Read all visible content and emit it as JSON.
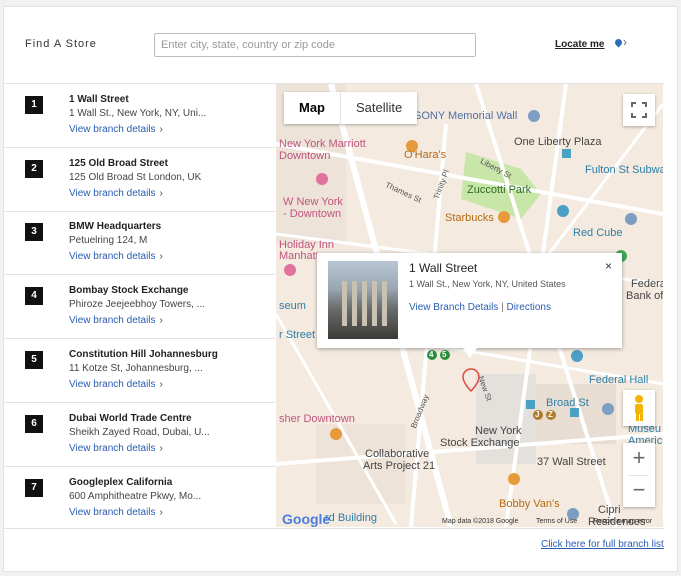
{
  "header": {
    "title": "Find A Store",
    "search_placeholder": "Enter city, state, country or zip code",
    "locate_label": "Locate me"
  },
  "stores": [
    {
      "num": "1",
      "name": "1 Wall Street",
      "address": "1 Wall St., New York, NY, Uni...",
      "link": "View branch details"
    },
    {
      "num": "2",
      "name": "125 Old Broad Street",
      "address": "125 Old Broad St London, UK",
      "link": "View branch details"
    },
    {
      "num": "3",
      "name": "BMW Headquarters",
      "address": "Petuelring 124, M",
      "link": "View branch details"
    },
    {
      "num": "4",
      "name": "Bombay Stock Exchange",
      "address": "Phiroze Jeejeebhoy Towers, ...",
      "link": "View branch details"
    },
    {
      "num": "5",
      "name": "Constitution Hill Johannesburg",
      "address": "11 Kotze St, Johannesburg, ...",
      "link": "View branch details"
    },
    {
      "num": "6",
      "name": "Dubai World Trade Centre",
      "address": "Sheikh Zayed Road, Dubai, U...",
      "link": "View branch details"
    },
    {
      "num": "7",
      "name": "Googleplex California",
      "address": "600 Amphitheatre Pkwy, Mo...",
      "link": "View branch details"
    }
  ],
  "map": {
    "type_buttons": [
      "Map",
      "Satellite"
    ],
    "labels": {
      "sony": "SONY Memorial Wall",
      "marriott_1": "New York Marriott",
      "marriott_2": "Downtown",
      "ohara": "O'Hara's",
      "liberty_plaza": "One Liberty Plaza",
      "liberty_st": "Liberty St",
      "fulton": "Fulton St Subwa",
      "zuccotti": "Zuccotti Park",
      "w_hotel_1": "W New York",
      "w_hotel_2": "- Downtown",
      "thames": "Thames St",
      "trinity": "Trinity Pl",
      "starbucks": "Starbucks",
      "redcube": "Red Cube",
      "holiday_1": "Holiday Inn",
      "holiday_2": "Manhatta",
      "museum_left": "seum",
      "rector": "r Street",
      "federal_1": "Federa",
      "federal_2": "Bank of",
      "federal_hall": "Federal Hall",
      "broad_st": "Broad St",
      "nyse_1": "New York",
      "nyse_2": "Stock Exchange",
      "broadway": "Broadway",
      "new_st": "New St",
      "sher": "sher Downtown",
      "collab_1": "Collaborative",
      "collab_2": "Arts Project 21",
      "wall37": "37 Wall Street",
      "museum_right_1": "Museu",
      "museum_right_2": "Americ",
      "bobby": "Bobby Van's",
      "cipri_1": "Cipri",
      "cipri_2": "Residences",
      "building": "rd Building"
    },
    "attribution": {
      "data": "Map data ©2018 Google",
      "terms": "Terms of Use",
      "report": "Report a map error"
    },
    "google_logo": "Google",
    "info_window": {
      "title": "1 Wall Street",
      "address": "1 Wall St., New York, NY, United States",
      "details_link": "View Branch Details",
      "separator": "|",
      "directions_link": "Directions",
      "close": "×"
    },
    "badges": {
      "j": "J",
      "z": "Z",
      "four": "4",
      "five": "5"
    },
    "zoom_in": "+",
    "zoom_out": "−"
  },
  "footer": {
    "full_list_link": "Click here for full branch list"
  },
  "colors": {
    "link": "#2a5db0",
    "park": "#c8e6a7",
    "map_bg": "#f4eae0",
    "road": "#ffffff"
  }
}
